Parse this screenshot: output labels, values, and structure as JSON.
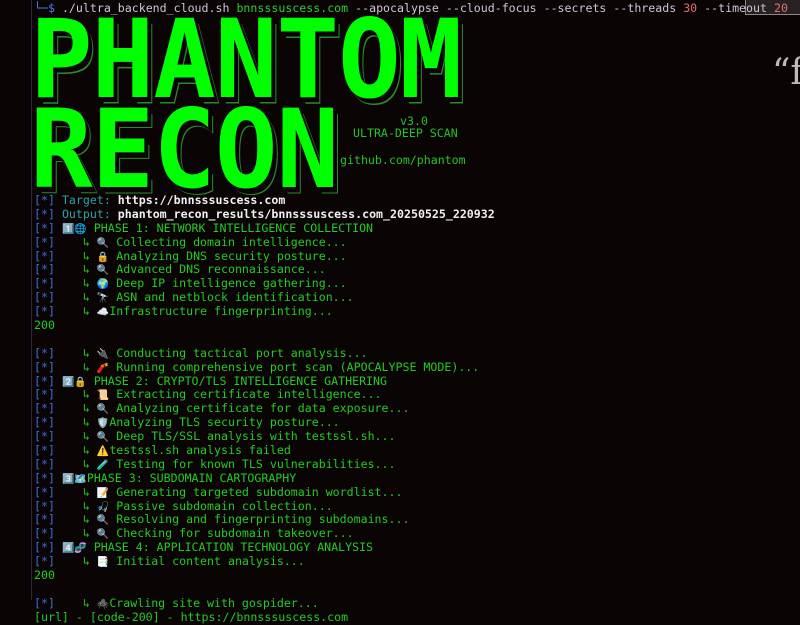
{
  "command": {
    "prompt": "└─$",
    "script": "./ultra_backend_cloud.sh",
    "host": "bnnsssuscess.com",
    "flags1": "--apocalypse --cloud-focus --secrets --threads",
    "threads": "30",
    "flags2": "--timeout",
    "timeout": "20"
  },
  "banner": {
    "logo_line1": "PHANTOM",
    "logo_line2": "RECON",
    "version": "v3.0",
    "mode": "ULTRA-DEEP SCAN",
    "link": "github.com/phantom",
    "quote_fragment": "“f"
  },
  "colors": {
    "accent": "#00ff00",
    "prefix": "#3d6fd8",
    "label": "#2aa3a3",
    "text": "#22cc22",
    "background": "#0b0405"
  },
  "log": [
    {
      "prefix": "[*]",
      "label": "Target:",
      "value": "https://bnnsssuscess.com"
    },
    {
      "prefix": "[*]",
      "label": "Output:",
      "value": "phantom_recon_results/bnnsssuscess.com_20250525_220932"
    },
    {
      "prefix": "[*]",
      "icon": "1️⃣🌐",
      "text": "PHASE 1: NETWORK INTELLIGENCE COLLECTION"
    },
    {
      "prefix": "[*]",
      "sub": true,
      "icon": "🔍",
      "text": "Collecting domain intelligence..."
    },
    {
      "prefix": "[*]",
      "sub": true,
      "icon": "🔒",
      "text": "Analyzing DNS security posture..."
    },
    {
      "prefix": "[*]",
      "sub": true,
      "icon": "🔍",
      "text": "Advanced DNS reconnaissance..."
    },
    {
      "prefix": "[*]",
      "sub": true,
      "icon": "🌍",
      "text": "Deep IP intelligence gathering..."
    },
    {
      "prefix": "[*]",
      "sub": true,
      "icon": "🔭",
      "text": "ASN and netblock identification..."
    },
    {
      "prefix": "[*]",
      "sub": true,
      "icon": "☁️",
      "tight": true,
      "text": "Infrastructure fingerprinting..."
    },
    {
      "plain": "200"
    },
    {
      "plain": ""
    },
    {
      "prefix": "[*]",
      "sub": true,
      "icon": "🔌",
      "text": "Conducting tactical port analysis..."
    },
    {
      "prefix": "[*]",
      "sub": true,
      "icon": "🧨",
      "text": "Running comprehensive port scan (APOCALYPSE MODE)..."
    },
    {
      "prefix": "[*]",
      "icon": "2️⃣🔒",
      "text": "PHASE 2: CRYPTO/TLS INTELLIGENCE GATHERING"
    },
    {
      "prefix": "[*]",
      "sub": true,
      "icon": "📜",
      "text": "Extracting certificate intelligence..."
    },
    {
      "prefix": "[*]",
      "sub": true,
      "icon": "🔍",
      "text": "Analyzing certificate for data exposure..."
    },
    {
      "prefix": "[*]",
      "sub": true,
      "icon": "🛡️",
      "tight": true,
      "text": "Analyzing TLS security posture..."
    },
    {
      "prefix": "[*]",
      "sub": true,
      "icon": "🔍",
      "text": "Deep TLS/SSL analysis with testssl.sh..."
    },
    {
      "prefix": "[*]",
      "sub": true,
      "icon": "⚠️",
      "tight": true,
      "text": "testssl.sh analysis failed"
    },
    {
      "prefix": "[*]",
      "sub": true,
      "icon": "🧪",
      "text": "Testing for known TLS vulnerabilities..."
    },
    {
      "prefix": "[*]",
      "icon": "3️⃣🗺️",
      "tight": true,
      "text": "PHASE 3: SUBDOMAIN CARTOGRAPHY"
    },
    {
      "prefix": "[*]",
      "sub": true,
      "icon": "📝",
      "text": "Generating targeted subdomain wordlist..."
    },
    {
      "prefix": "[*]",
      "sub": true,
      "icon": "🎣",
      "text": "Passive subdomain collection..."
    },
    {
      "prefix": "[*]",
      "sub": true,
      "icon": "🔍",
      "text": "Resolving and fingerprinting subdomains..."
    },
    {
      "prefix": "[*]",
      "sub": true,
      "icon": "🔍",
      "text": "Checking for subdomain takeover..."
    },
    {
      "prefix": "[*]",
      "icon": "4️⃣🧬",
      "text": "PHASE 4: APPLICATION TECHNOLOGY ANALYSIS"
    },
    {
      "prefix": "[*]",
      "sub": true,
      "icon": "📑",
      "text": "Initial content analysis..."
    },
    {
      "plain": "200"
    },
    {
      "plain": ""
    },
    {
      "prefix": "[*]",
      "sub": true,
      "icon": "🕷️",
      "tight": true,
      "text": "Crawling site with gospider..."
    },
    {
      "plain": "[url] - [code-200] - https://bnnsssuscess.com"
    }
  ]
}
